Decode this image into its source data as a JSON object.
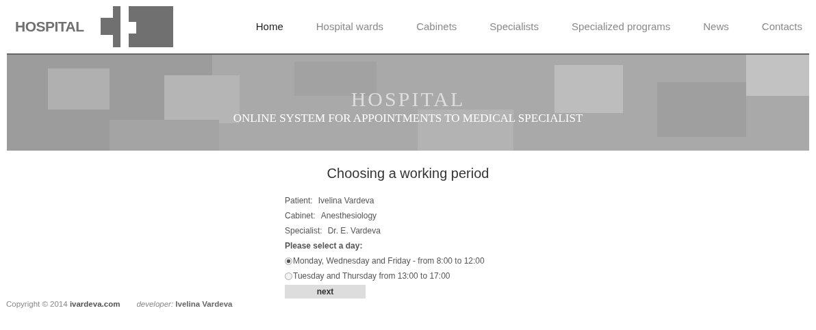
{
  "logo": {
    "text": "HOSPITAL"
  },
  "nav": [
    {
      "label": "Home",
      "selected": true
    },
    {
      "label": "Hospital wards",
      "selected": false
    },
    {
      "label": "Cabinets",
      "selected": false
    },
    {
      "label": "Specialists",
      "selected": false
    },
    {
      "label": "Specialized programs",
      "selected": false
    },
    {
      "label": "News",
      "selected": false
    },
    {
      "label": "Contacts",
      "selected": false
    }
  ],
  "banner": {
    "title": "HOSPITAL",
    "subtitle": "ONLINE SYSTEM FOR APPOINTMENTS TO MEDICAL SPECIALIST"
  },
  "heading": "Choosing a working period",
  "details": [
    {
      "label": "Patient:",
      "value": "Ivelina Vardeva"
    },
    {
      "label": "Cabinet:",
      "value": "Anesthesiology"
    },
    {
      "label": "Specialist:",
      "value": "Dr. E. Vardeva"
    }
  ],
  "prompt": "Please select a day:",
  "options": [
    {
      "label": "Monday, Wednesday and Friday - from 8:00 to 12:00",
      "selected": true
    },
    {
      "label": "Tuesday and Thursday from 13:00 to 17:00",
      "selected": false
    }
  ],
  "button": "next",
  "footer": {
    "copyright": "Copyright © 2014",
    "site": "ivardeva.com",
    "developer_label": "developer:",
    "developer": "Ivelina Vardeva"
  }
}
